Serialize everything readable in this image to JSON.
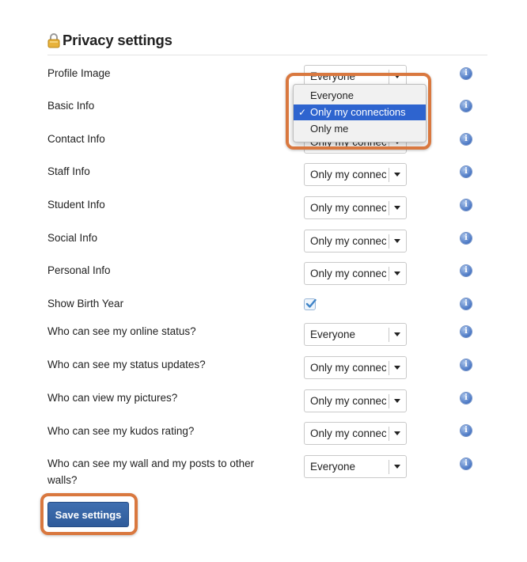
{
  "page": {
    "title": "Privacy settings"
  },
  "rows": [
    {
      "label": "Profile Image",
      "value": "Everyone"
    },
    {
      "label": "Basic Info",
      "value": "Only my connections"
    },
    {
      "label": "Contact Info",
      "value": "Only my connec"
    },
    {
      "label": "Staff Info",
      "value": "Only my connec"
    },
    {
      "label": "Student Info",
      "value": "Only my connec"
    },
    {
      "label": "Social Info",
      "value": "Only my connec"
    },
    {
      "label": "Personal Info",
      "value": "Only my connec"
    },
    {
      "label": "Show Birth Year",
      "checked": true
    },
    {
      "label": "Who can see my online status?",
      "value": "Everyone"
    },
    {
      "label": "Who can see my status updates?",
      "value": "Only my connec"
    },
    {
      "label": "Who can view my pictures?",
      "value": "Only my connec"
    },
    {
      "label": "Who can see my kudos rating?",
      "value": "Only my connec"
    },
    {
      "label": "Who can see my wall and my posts to other walls?",
      "value": "Everyone"
    }
  ],
  "dropdown": {
    "options": [
      "Everyone",
      "Only my connections",
      "Only me"
    ],
    "selected": "Only my connections",
    "check_mark": "✓"
  },
  "icons": {
    "lock": "lock-icon",
    "info": "info-icon",
    "info_glyph": "i",
    "checkbox": "checkmark-icon"
  },
  "colors": {
    "accent_highlight": "#d9783f",
    "save_button": "#2f5b9a",
    "menu_selected": "#2e64cf",
    "info_icon": "#4a77c4"
  },
  "actions": {
    "save_label": "Save settings"
  }
}
